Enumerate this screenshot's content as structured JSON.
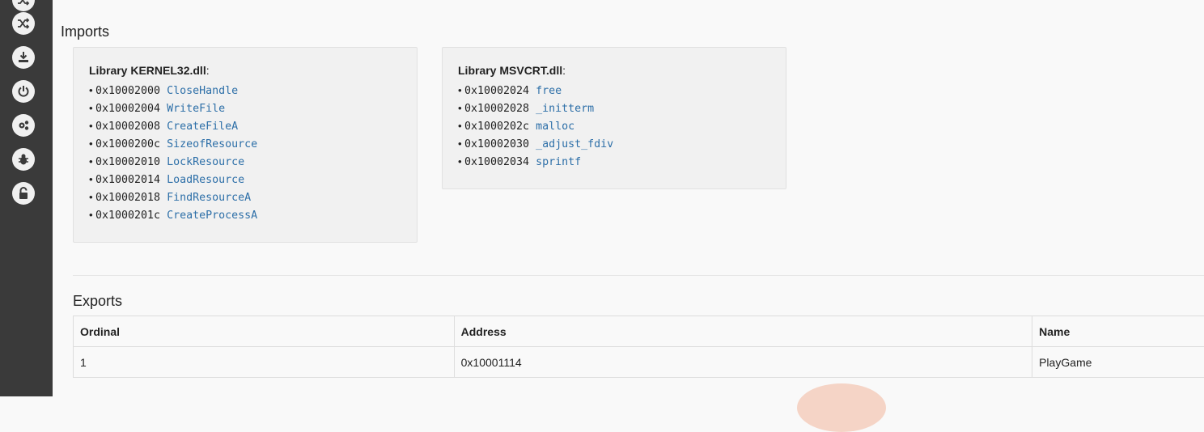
{
  "sidebar": {
    "icons": [
      {
        "name": "shuffle-icon"
      },
      {
        "name": "download-icon"
      },
      {
        "name": "power-icon"
      },
      {
        "name": "settings-gears-icon"
      },
      {
        "name": "bug-icon"
      },
      {
        "name": "unlock-icon"
      }
    ]
  },
  "imports": {
    "title": "Imports",
    "libraries": [
      {
        "prefix": "Library ",
        "name": "KERNEL32.dll",
        "suffix": ":",
        "functions": [
          {
            "address": "0x10002000",
            "name": "CloseHandle"
          },
          {
            "address": "0x10002004",
            "name": "WriteFile"
          },
          {
            "address": "0x10002008",
            "name": "CreateFileA"
          },
          {
            "address": "0x1000200c",
            "name": "SizeofResource"
          },
          {
            "address": "0x10002010",
            "name": "LockResource"
          },
          {
            "address": "0x10002014",
            "name": "LoadResource"
          },
          {
            "address": "0x10002018",
            "name": "FindResourceA"
          },
          {
            "address": "0x1000201c",
            "name": "CreateProcessA"
          }
        ]
      },
      {
        "prefix": "Library ",
        "name": "MSVCRT.dll",
        "suffix": ":",
        "functions": [
          {
            "address": "0x10002024",
            "name": "free"
          },
          {
            "address": "0x10002028",
            "name": "_initterm"
          },
          {
            "address": "0x1000202c",
            "name": "malloc"
          },
          {
            "address": "0x10002030",
            "name": "_adjust_fdiv"
          },
          {
            "address": "0x10002034",
            "name": "sprintf"
          }
        ]
      }
    ]
  },
  "exports": {
    "title": "Exports",
    "columns": [
      "Ordinal",
      "Address",
      "Name"
    ],
    "rows": [
      [
        "1",
        "0x10001114",
        "PlayGame"
      ]
    ]
  },
  "colors": {
    "sidebar": "#3a3a3a",
    "link": "#2d6fa8"
  }
}
